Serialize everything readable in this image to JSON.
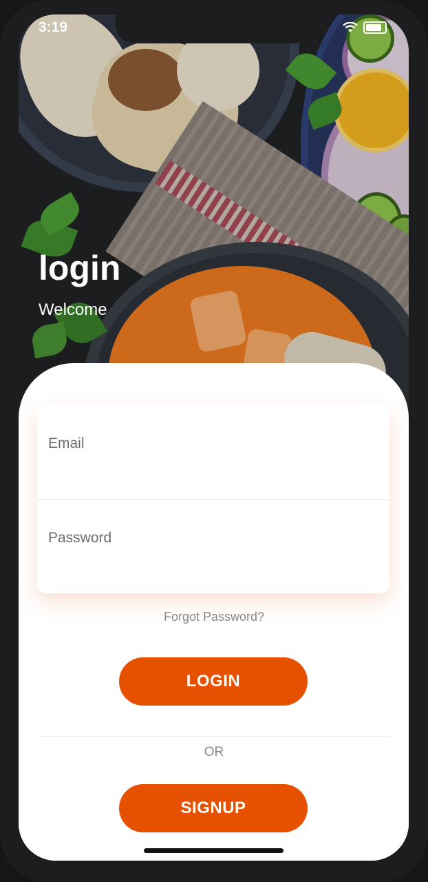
{
  "status_bar": {
    "time": "3:19"
  },
  "header": {
    "title": "login",
    "subtitle": "Welcome"
  },
  "form": {
    "email_placeholder": "Email",
    "password_placeholder": "Password"
  },
  "links": {
    "forgot_password": "Forgot Password?"
  },
  "buttons": {
    "login": "LOGIN",
    "signup": "SIGNUP"
  },
  "divider_text": "OR",
  "colors": {
    "accent": "#e65100",
    "background": "#ffffff",
    "muted_text": "#8a8a8a"
  }
}
